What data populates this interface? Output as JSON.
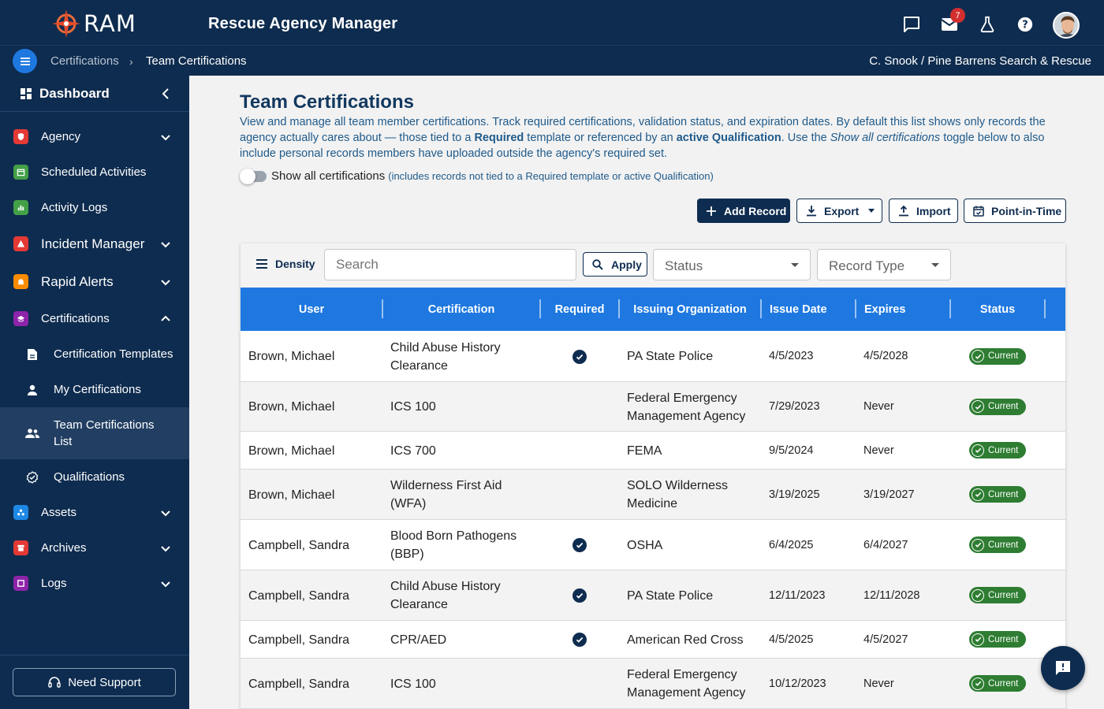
{
  "header": {
    "logo_text": "RAM",
    "app_title": "Rescue Agency Manager",
    "mail_badge": "7"
  },
  "breadcrumb": {
    "items": [
      "Certifications",
      "Team Certifications"
    ],
    "separator": "›",
    "user_agency": "C. Snook / Pine Barrens Search & Rescue"
  },
  "sidebar": {
    "dashboard": "Dashboard",
    "items": [
      {
        "label": "Agency",
        "icon": "shield-icon",
        "color": "#e53935"
      },
      {
        "label": "Scheduled Activities",
        "icon": "calendar-icon",
        "color": "#43a047"
      },
      {
        "label": "Activity Logs",
        "icon": "chart-icon",
        "color": "#43a047"
      },
      {
        "label": "Incident Manager",
        "icon": "warning-icon",
        "color": "#e53935"
      },
      {
        "label": "Rapid Alerts",
        "icon": "alarm-icon",
        "color": "#fb8c00"
      },
      {
        "label": "Certifications",
        "icon": "cert-icon",
        "color": "#8e24aa"
      },
      {
        "label": "Assets",
        "icon": "assets-icon",
        "color": "#1e88e5"
      },
      {
        "label": "Archives",
        "icon": "archive-icon",
        "color": "#e53935"
      },
      {
        "label": "Logs",
        "icon": "logs-icon",
        "color": "#8e24aa"
      }
    ],
    "sub_items": [
      {
        "label": "Certification Templates",
        "icon": "document-icon"
      },
      {
        "label": "My Certifications",
        "icon": "person-icon"
      },
      {
        "label": "Team Certifications List",
        "icon": "group-icon"
      },
      {
        "label": "Qualifications",
        "icon": "badge-check-icon"
      }
    ],
    "support": "Need Support"
  },
  "main": {
    "title": "Team Certifications",
    "desc_1": "View and manage all team member certifications. Track required certifications, validation status, and expiration dates. By default this list shows only records the agency actually cares about — those tied to a ",
    "desc_required": "Required",
    "desc_2": " template or referenced by an ",
    "desc_active": "active Qualification",
    "desc_3": ". Use the ",
    "desc_toggle": "Show all certifications",
    "desc_4": " toggle below to also include personal records members have uploaded outside the agency's required set.",
    "toggle_label": "Show all certifications",
    "toggle_note": "(includes records not tied to a Required template or active Qualification)",
    "buttons": {
      "add": "Add Record",
      "export": "Export",
      "import": "Import",
      "pit": "Point-in-Time"
    }
  },
  "table": {
    "density": "Density",
    "search_placeholder": "Search",
    "apply": "Apply",
    "status_filter": "Status",
    "type_filter": "Record Type",
    "columns": [
      "User",
      "Certification",
      "Required",
      "Issuing Organization",
      "Issue Date",
      "Expires",
      "Status"
    ],
    "rows": [
      {
        "user": "Brown, Michael",
        "cert": "Child Abuse History Clearance",
        "required": true,
        "org": "PA State Police",
        "issue": "4/5/2023",
        "expires": "4/5/2028",
        "status": "Current"
      },
      {
        "user": "Brown, Michael",
        "cert": "ICS 100",
        "required": false,
        "org": "Federal Emergency Management Agency",
        "issue": "7/29/2023",
        "expires": "Never",
        "status": "Current"
      },
      {
        "user": "Brown, Michael",
        "cert": "ICS 700",
        "required": false,
        "org": "FEMA",
        "issue": "9/5/2024",
        "expires": "Never",
        "status": "Current"
      },
      {
        "user": "Brown, Michael",
        "cert": "Wilderness First Aid (WFA)",
        "required": false,
        "org": "SOLO Wilderness Medicine",
        "issue": "3/19/2025",
        "expires": "3/19/2027",
        "status": "Current"
      },
      {
        "user": "Campbell, Sandra",
        "cert": "Blood Born Pathogens (BBP)",
        "required": true,
        "org": "OSHA",
        "issue": "6/4/2025",
        "expires": "6/4/2027",
        "status": "Current"
      },
      {
        "user": "Campbell, Sandra",
        "cert": "Child Abuse History Clearance",
        "required": true,
        "org": "PA State Police",
        "issue": "12/11/2023",
        "expires": "12/11/2028",
        "status": "Current"
      },
      {
        "user": "Campbell, Sandra",
        "cert": "CPR/AED",
        "required": true,
        "org": "American Red Cross",
        "issue": "4/5/2025",
        "expires": "4/5/2027",
        "status": "Current"
      },
      {
        "user": "Campbell, Sandra",
        "cert": "ICS 100",
        "required": false,
        "org": "Federal Emergency Management Agency",
        "issue": "10/12/2023",
        "expires": "Never",
        "status": "Current"
      }
    ]
  },
  "colors": {
    "navy": "#0e2c4f",
    "header_blue": "#1e78e0",
    "status_green": "#2e7d32"
  }
}
